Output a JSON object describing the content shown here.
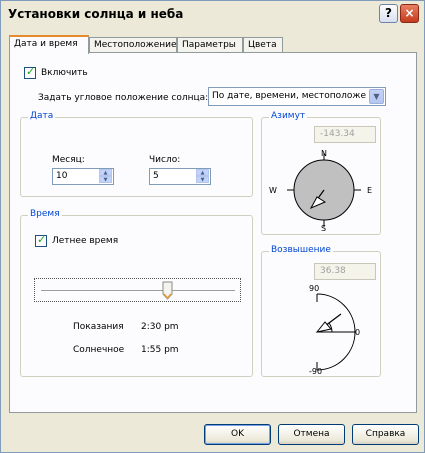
{
  "window": {
    "title": "Установки солнца и неба",
    "help_icon": "?",
    "close_icon": "×"
  },
  "tabs": [
    {
      "label": "Дата и время"
    },
    {
      "label": "Местоположение"
    },
    {
      "label": "Параметры"
    },
    {
      "label": "Цвета"
    }
  ],
  "enable_label": "Включить",
  "position_label": "Задать угловое положение солнца:",
  "position_value": "По дате, времени, местоположе",
  "date_group": {
    "title": "Дата",
    "month_label": "Месяц:",
    "month_value": "10",
    "day_label": "Число:",
    "day_value": "5"
  },
  "azimuth_group": {
    "title": "Азимут",
    "value": "-143.34",
    "north": "N",
    "south": "S",
    "west": "W",
    "east": "E"
  },
  "time_group": {
    "title": "Время",
    "dst_label": "Летнее время",
    "time_slider_fraction": 0.68,
    "clock_label": "Показания",
    "clock_value": "2:30 pm",
    "solar_label": "Солнечное",
    "solar_value": "1:55 pm"
  },
  "elevation_group": {
    "title": "Возвышение",
    "value": "36.38",
    "top_label": "90",
    "zero_label": "0",
    "bottom_label": "-90"
  },
  "buttons": {
    "ok": "OK",
    "cancel": "Отмена",
    "help": "Справка"
  }
}
